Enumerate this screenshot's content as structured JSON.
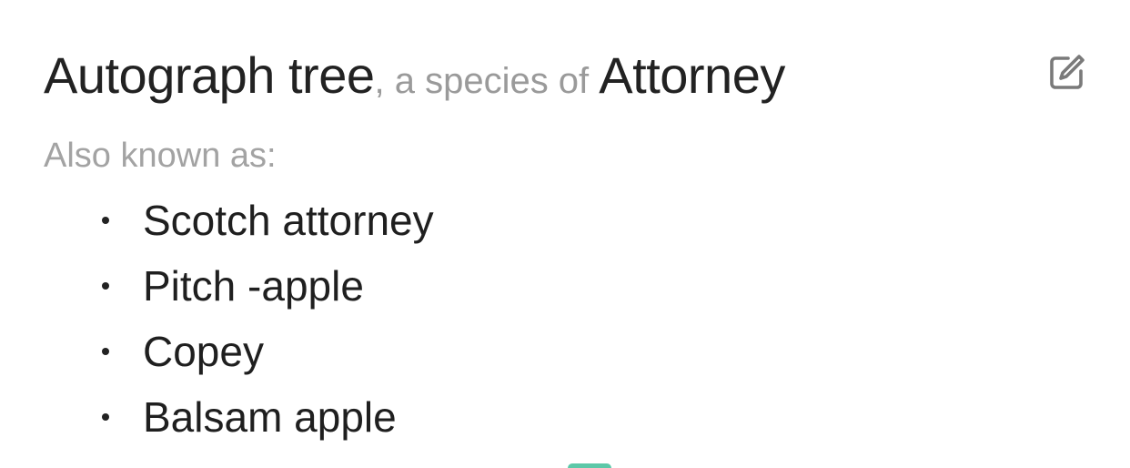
{
  "header": {
    "species_name": "Autograph tree",
    "connector": ", a species of ",
    "genus_name": "Attorney"
  },
  "edit_button": {
    "icon": "edit-icon"
  },
  "aliases": {
    "label": "Also known as:",
    "items": [
      "Scotch attorney",
      "Pitch -apple",
      "Copey",
      "Balsam apple"
    ]
  },
  "colors": {
    "text_primary": "#222222",
    "text_secondary": "#9a9a9a",
    "icon": "#7a7a7a",
    "accent": "#5cc8a8"
  }
}
